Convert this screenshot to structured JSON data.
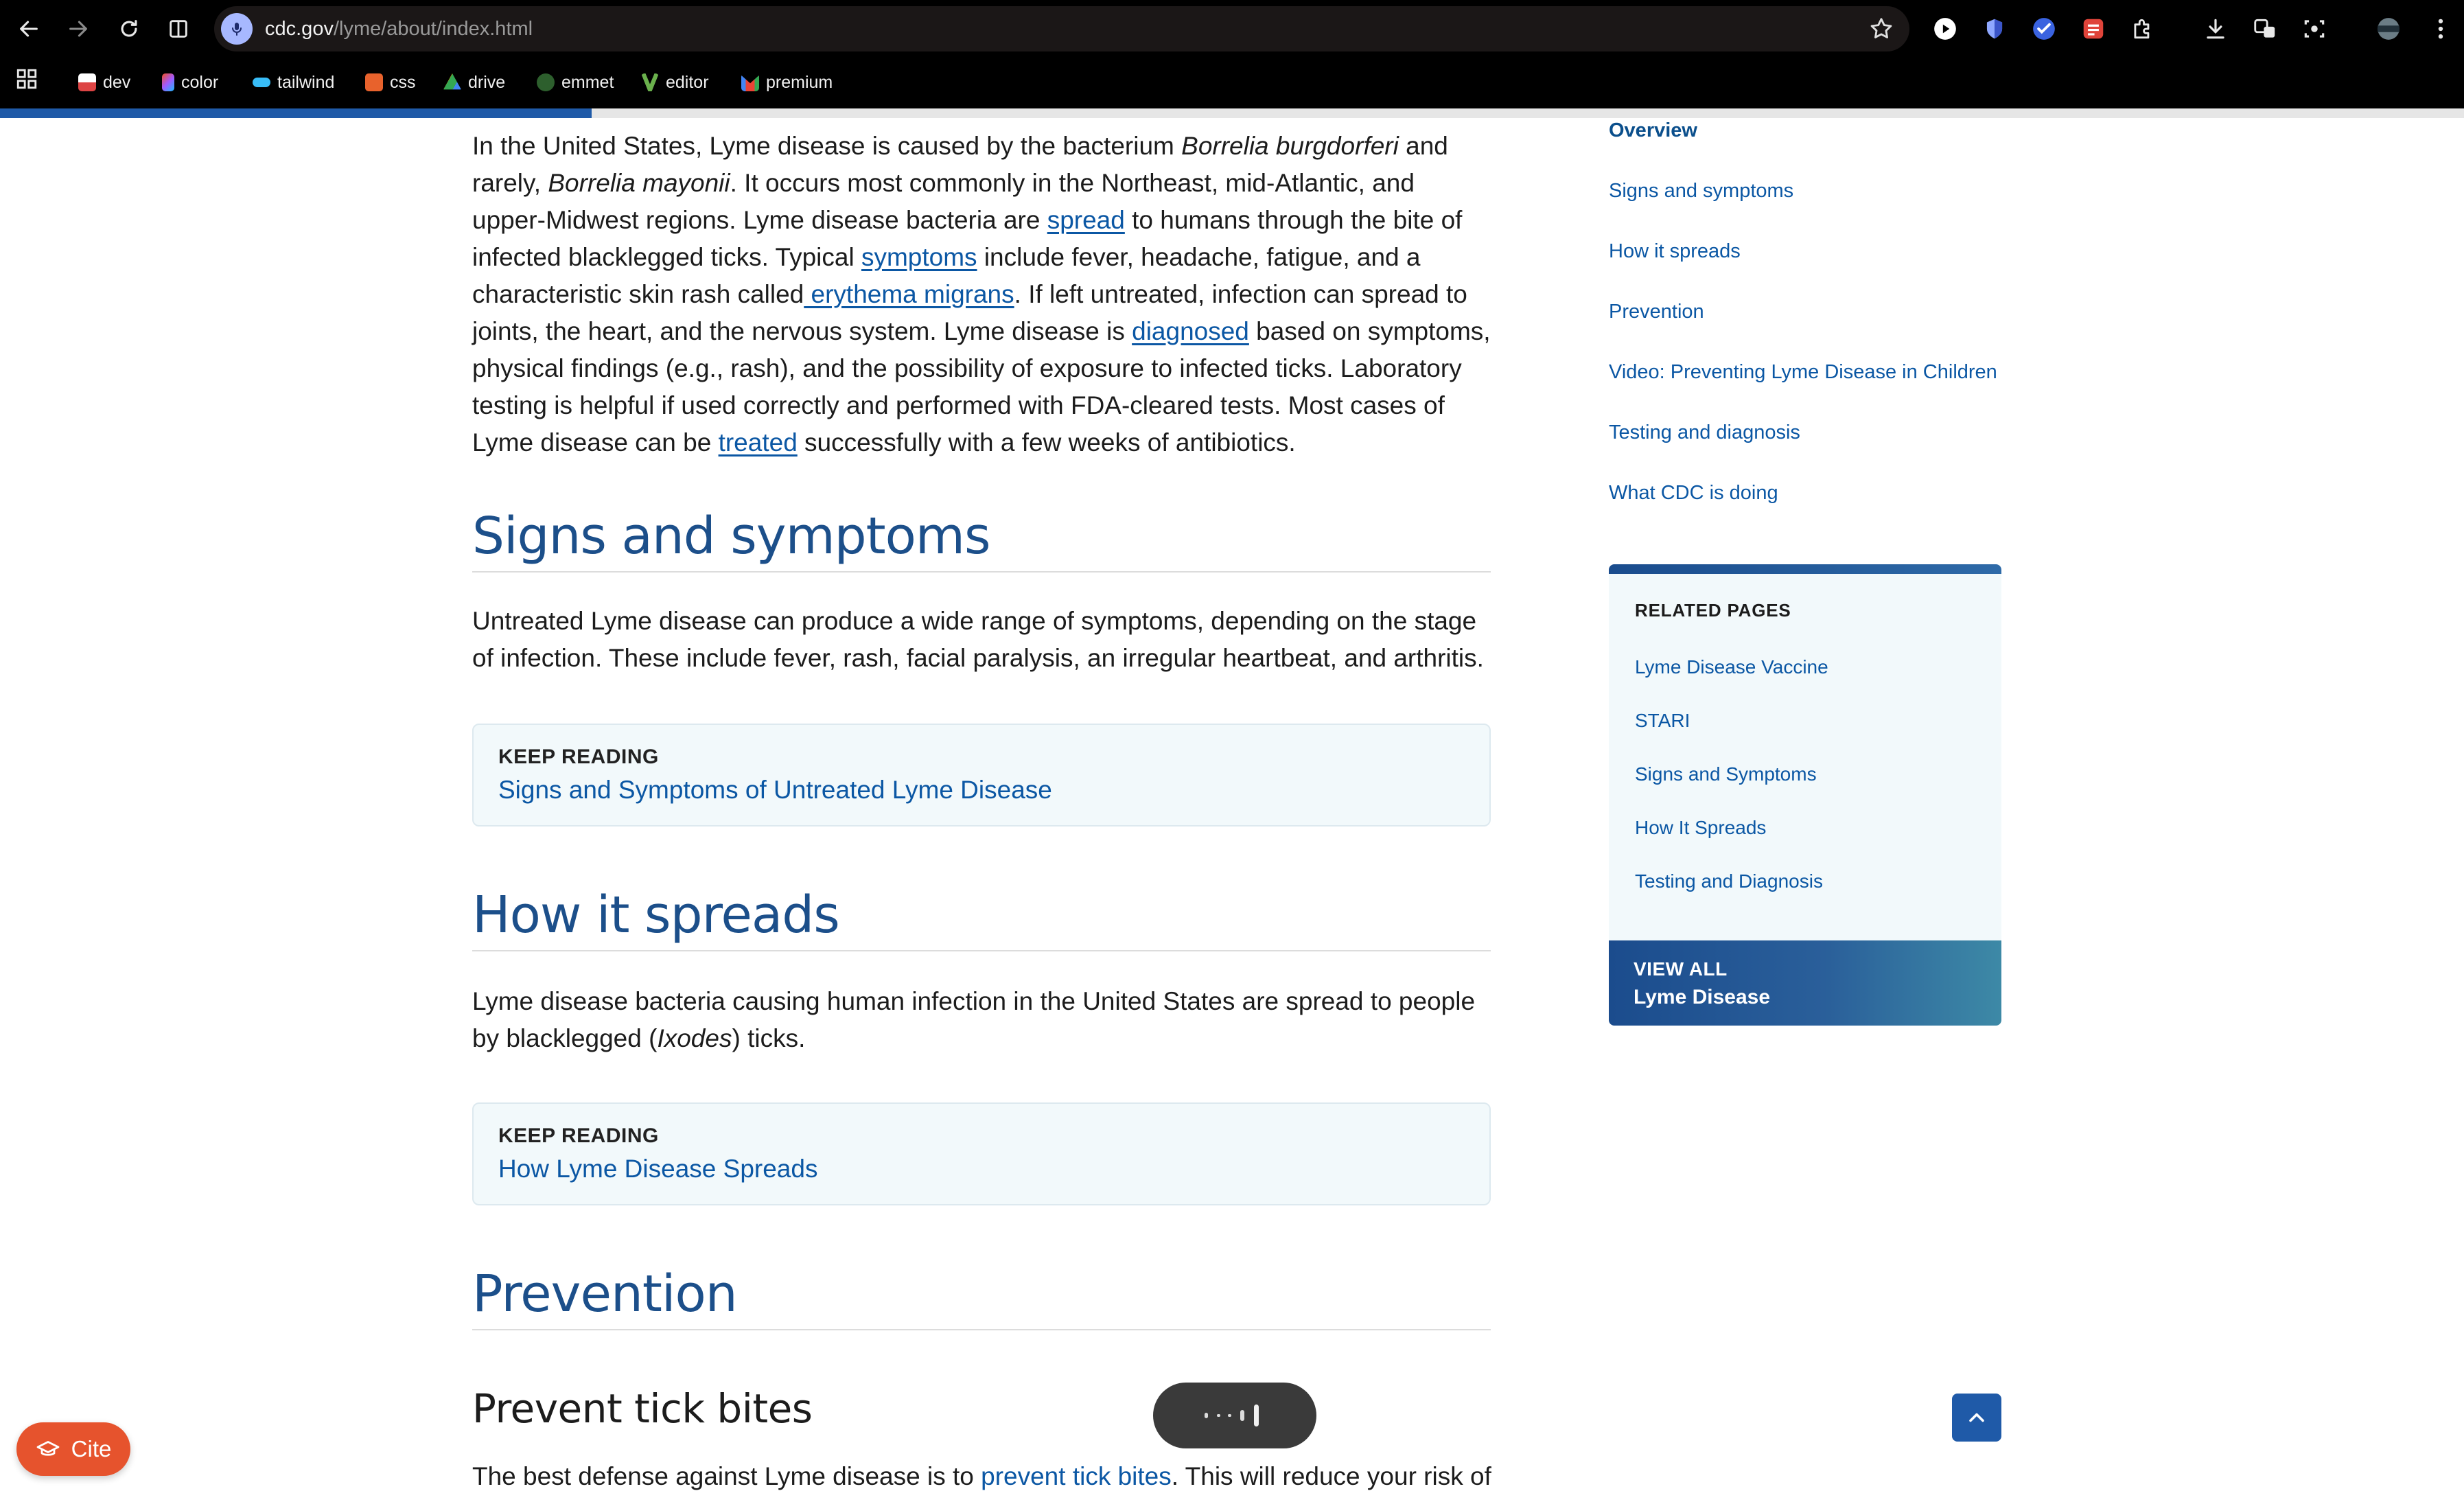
{
  "browser": {
    "url_host": "cdc.gov",
    "url_path": "/lyme/about/index.html",
    "bookmarks": [
      "dev",
      "color",
      "tailwind",
      "css",
      "drive",
      "emmet",
      "editor",
      "premium"
    ]
  },
  "reading_progress": 0.24,
  "intro": {
    "t1": "In the United States, Lyme disease is caused by the bacterium ",
    "i1": "Borrelia burgdorferi",
    "t2": " and rarely, ",
    "i2": "Borrelia mayonii",
    "t3": ". It occurs most commonly in the Northeast, mid-Atlantic, and upper-Midwest regions. Lyme disease bacteria are ",
    "l_spread": "spread",
    "t4": " to humans through the bite of infected blacklegged ticks. Typical ",
    "l_symptoms": "symptoms",
    "t5": " include fever, headache, fatigue, and a characteristic skin rash called",
    "l_em": " erythema migrans",
    "t6": ". If left untreated, infection can spread to joints, the heart, and the nervous system. Lyme disease is ",
    "l_diagnosed": "diagnosed",
    "t7": " based on symptoms, physical findings (e.g., rash), and the possibility of exposure to infected ticks. Laboratory testing is helpful if used correctly and performed with FDA-cleared tests. Most cases of Lyme disease can be ",
    "l_treated": "treated",
    "t8": " successfully with a few weeks of antibiotics."
  },
  "signs": {
    "heading": "Signs and symptoms",
    "body": "Untreated Lyme disease can produce a wide range of symptoms, depending on the stage of infection. These include fever, rash, facial paralysis, an irregular heartbeat, and arthritis.",
    "keep_label": "KEEP READING",
    "keep_link": "Signs and Symptoms of Untreated Lyme Disease"
  },
  "spreads": {
    "heading": "How it spreads",
    "body1": "Lyme disease bacteria causing human infection in the United States are spread to people by blacklegged (",
    "body_i": "Ixodes",
    "body2": ") ticks.",
    "keep_label": "KEEP READING",
    "keep_link": "How Lyme Disease Spreads"
  },
  "prevention": {
    "heading": "Prevention",
    "subheading": "Prevent tick bites",
    "t1": "The best defense against Lyme disease is to ",
    "link": "prevent tick bites",
    "t2": ". This will reduce your risk of"
  },
  "toc": [
    "Overview",
    "Signs and symptoms",
    "How it spreads",
    "Prevention",
    "Video: Preventing Lyme Disease in Children",
    "Testing and diagnosis",
    "What CDC is doing"
  ],
  "related": {
    "heading": "RELATED PAGES",
    "items": [
      "Lyme Disease Vaccine",
      "STARI",
      "Signs and Symptoms",
      "How It Spreads",
      "Testing and Diagnosis"
    ],
    "view_all_label": "VIEW ALL",
    "view_all_target": "Lyme Disease"
  },
  "cite_label": "Cite",
  "colors": {
    "accent": "#1f5aa8",
    "heading": "#1c4f8a",
    "link": "#0b57a4",
    "cite": "#e6532d"
  }
}
